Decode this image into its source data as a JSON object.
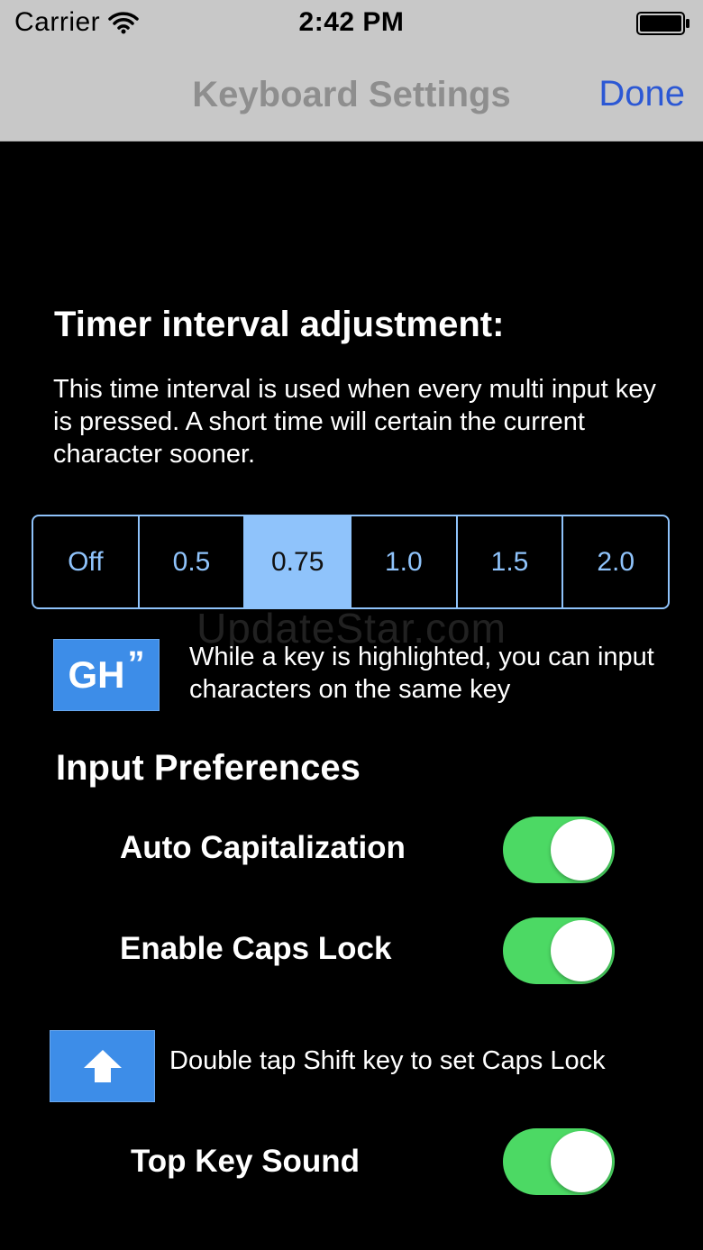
{
  "status_bar": {
    "carrier": "Carrier",
    "wifi_icon": "wifi-icon",
    "time": "2:42 PM",
    "battery_icon": "battery-full-icon"
  },
  "nav": {
    "title": "Keyboard Settings",
    "done_label": "Done"
  },
  "timer": {
    "title": "Timer interval adjustment:",
    "description": "This time interval is used when every multi input key is pressed. A short time will certain the current character sooner.",
    "options": [
      "Off",
      "0.5",
      "0.75",
      "1.0",
      "1.5",
      "2.0"
    ],
    "selected": "0.75"
  },
  "watermark": "UpdateStar.com",
  "highlight_hint": {
    "key_label": "GH",
    "key_quote": "”",
    "text": "While a key is highlighted, you can input characters on the same key"
  },
  "preferences": {
    "title": "Input Preferences",
    "auto_capitalization": {
      "label": "Auto Capitalization",
      "on": true
    },
    "enable_caps_lock": {
      "label": "Enable Caps Lock",
      "on": true
    },
    "caps_hint": {
      "icon": "shift-arrow-icon",
      "text": "Double tap Shift key to set Caps Lock"
    },
    "top_key_sound": {
      "label": "Top Key Sound",
      "on": true
    }
  },
  "colors": {
    "nav_background": "#c8c8c8",
    "accent_blue": "#2c58d4",
    "segment_blue": "#8fc3fb",
    "key_blue": "#3d8de8",
    "toggle_green": "#4cd964",
    "background": "#000000"
  }
}
